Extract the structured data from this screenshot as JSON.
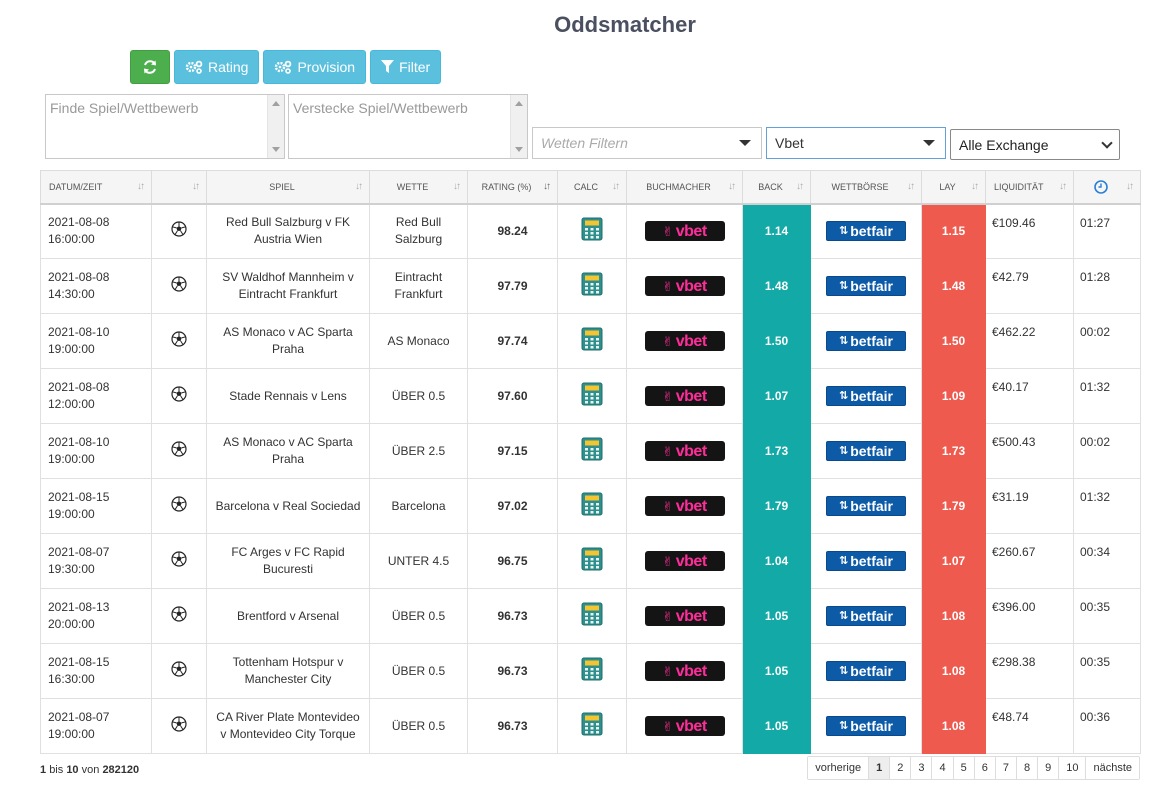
{
  "page": {
    "title": "Oddsmatcher"
  },
  "toolbar": {
    "rating_label": "Rating",
    "provision_label": "Provision",
    "filter_label": "Filter"
  },
  "filters": {
    "find_placeholder": "Finde Spiel/Wettbewerb",
    "hide_placeholder": "Verstecke Spiel/Wettbewerb",
    "bets_placeholder": "Wetten Filtern",
    "bookmaker_selected": "Vbet",
    "exchange_selected": "Alle Exchange"
  },
  "columns": {
    "date": "Datum/Zeit",
    "sport": "",
    "game": "Spiel",
    "bet": "Wette",
    "rating": "Rating (%)",
    "calc": "Calc",
    "bookmaker": "Buchmacher",
    "back": "Back",
    "exchange": "Wettbörse",
    "lay": "Lay",
    "liquidity": "Liquidität"
  },
  "brands": {
    "bookmaker": "vbet",
    "exchange": "betfair"
  },
  "colors": {
    "back": "#13a9a6",
    "lay": "#ef5a4f",
    "refresh": "#4cae4c",
    "tool": "#5bc0de"
  },
  "rows": [
    {
      "date": "2021-08-08",
      "time": "16:00:00",
      "game": "Red Bull Salzburg v FK Austria Wien",
      "bet": "Red Bull Salzburg",
      "rating": "98.24",
      "back": "1.14",
      "lay": "1.15",
      "liquidity": "€109.46",
      "age": "01:27"
    },
    {
      "date": "2021-08-08",
      "time": "14:30:00",
      "game": "SV Waldhof Mannheim v Eintracht Frankfurt",
      "bet": "Eintracht Frankfurt",
      "rating": "97.79",
      "back": "1.48",
      "lay": "1.48",
      "liquidity": "€42.79",
      "age": "01:28"
    },
    {
      "date": "2021-08-10",
      "time": "19:00:00",
      "game": "AS Monaco v AC Sparta Praha",
      "bet": "AS Monaco",
      "rating": "97.74",
      "back": "1.50",
      "lay": "1.50",
      "liquidity": "€462.22",
      "age": "00:02"
    },
    {
      "date": "2021-08-08",
      "time": "12:00:00",
      "game": "Stade Rennais v Lens",
      "bet": "ÜBER 0.5",
      "rating": "97.60",
      "back": "1.07",
      "lay": "1.09",
      "liquidity": "€40.17",
      "age": "01:32"
    },
    {
      "date": "2021-08-10",
      "time": "19:00:00",
      "game": "AS Monaco v AC Sparta Praha",
      "bet": "ÜBER 2.5",
      "rating": "97.15",
      "back": "1.73",
      "lay": "1.73",
      "liquidity": "€500.43",
      "age": "00:02"
    },
    {
      "date": "2021-08-15",
      "time": "19:00:00",
      "game": "Barcelona v Real Sociedad",
      "bet": "Barcelona",
      "rating": "97.02",
      "back": "1.79",
      "lay": "1.79",
      "liquidity": "€31.19",
      "age": "01:32"
    },
    {
      "date": "2021-08-07",
      "time": "19:30:00",
      "game": "FC Arges v FC Rapid Bucuresti",
      "bet": "UNTER 4.5",
      "rating": "96.75",
      "back": "1.04",
      "lay": "1.07",
      "liquidity": "€260.67",
      "age": "00:34"
    },
    {
      "date": "2021-08-13",
      "time": "20:00:00",
      "game": "Brentford v Arsenal",
      "bet": "ÜBER 0.5",
      "rating": "96.73",
      "back": "1.05",
      "lay": "1.08",
      "liquidity": "€396.00",
      "age": "00:35"
    },
    {
      "date": "2021-08-15",
      "time": "16:30:00",
      "game": "Tottenham Hotspur v Manchester City",
      "bet": "ÜBER 0.5",
      "rating": "96.73",
      "back": "1.05",
      "lay": "1.08",
      "liquidity": "€298.38",
      "age": "00:35"
    },
    {
      "date": "2021-08-07",
      "time": "19:00:00",
      "game": "CA River Plate Montevideo v Montevideo City Torque",
      "bet": "ÜBER 0.5",
      "rating": "96.73",
      "back": "1.05",
      "lay": "1.08",
      "liquidity": "€48.74",
      "age": "00:36"
    }
  ],
  "pagination": {
    "from": "1",
    "bis_label": "bis",
    "to": "10",
    "von_label": "von",
    "total": "282120",
    "prev_label": "vorherige",
    "pages": [
      "1",
      "2",
      "3",
      "4",
      "5",
      "6",
      "7",
      "8",
      "9",
      "10"
    ],
    "current": "1",
    "next_label": "nächste"
  }
}
